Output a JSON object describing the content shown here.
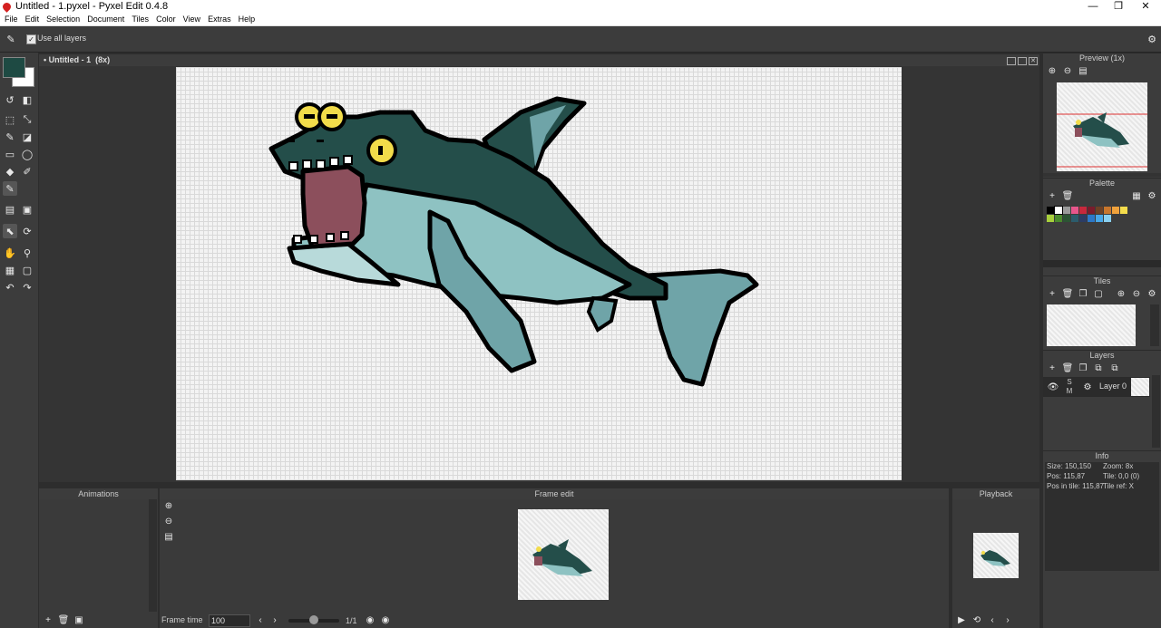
{
  "window": {
    "title": "Untitled - 1.pyxel - Pyxel Edit 0.4.8",
    "controls": [
      "—",
      "❐",
      "✕"
    ]
  },
  "menu": [
    "File",
    "Edit",
    "Selection",
    "Document",
    "Tiles",
    "Color",
    "View",
    "Extras",
    "Help"
  ],
  "options": {
    "use_all_layers_label": "Use all layers",
    "use_all_layers_checked": true
  },
  "colors": {
    "primary": "#1e4a43",
    "secondary": "#ffffff",
    "accent_red": "#d42020"
  },
  "canvas": {
    "tab_title": "Untitled - 1",
    "zoom_label": "(8x)"
  },
  "preview": {
    "title": "Preview (1x)"
  },
  "palette": {
    "title": "Palette",
    "swatches": [
      "#000000",
      "#ffffff",
      "#9b9b9b",
      "#e8568c",
      "#c8283c",
      "#7a1c2c",
      "#6e4226",
      "#c8762c",
      "#f0a23c",
      "#f4dc4c",
      "#a8d03c",
      "#4a8a2c",
      "#2c5434",
      "#2c5c6c",
      "#2c3c64",
      "#2c78c8",
      "#48a8e8",
      "#8ad0f0"
    ]
  },
  "tiles": {
    "title": "Tiles"
  },
  "layers": {
    "title": "Layers",
    "items": [
      {
        "name": "Layer 0",
        "visible": true
      }
    ]
  },
  "info": {
    "title": "Info",
    "size": "Size: 150,150",
    "zoom": "Zoom: 8x",
    "pos": "Pos: 115,87",
    "tile": "Tile: 0,0 (0)",
    "pos_in_tile": "Pos in tile: 115,87",
    "tile_ref": "Tile ref: X"
  },
  "animations": {
    "title": "Animations"
  },
  "frame_edit": {
    "title": "Frame edit",
    "frame_time_label": "Frame time",
    "frame_time_value": "100",
    "frame_counter": "1/1"
  },
  "playback": {
    "title": "Playback"
  }
}
